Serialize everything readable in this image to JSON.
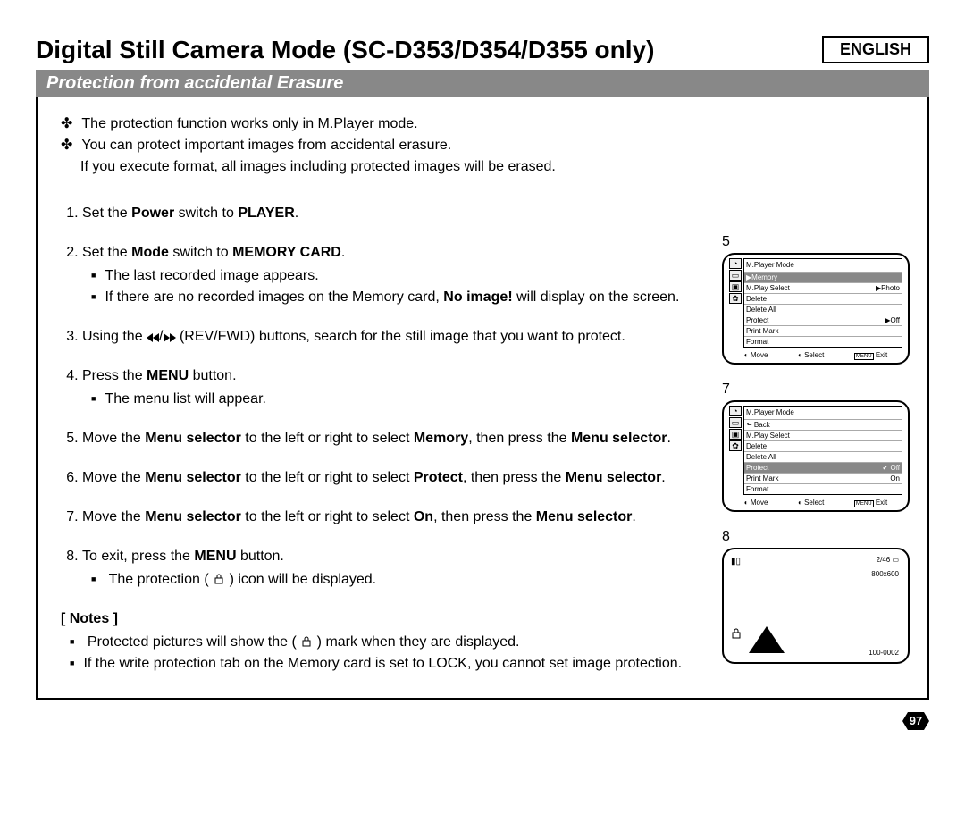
{
  "language": "ENGLISH",
  "title": "Digital Still Camera Mode (SC-D353/D354/D355 only)",
  "subtitle": "Protection from accidental Erasure",
  "intro": {
    "b1": "The protection function works only in M.Player mode.",
    "b2": "You can protect important images from accidental erasure.",
    "b2b": "If you execute format, all images including protected images will be erased."
  },
  "steps": {
    "s1a": "Set the ",
    "s1b": "Power",
    "s1c": " switch to ",
    "s1d": "PLAYER",
    "s1e": ".",
    "s2a": "Set the ",
    "s2b": "Mode",
    "s2c": " switch to ",
    "s2d": "MEMORY CARD",
    "s2e": ".",
    "s2sub1": "The last recorded image appears.",
    "s2sub2a": "If there are no recorded images on the Memory card, ",
    "s2sub2b": "No image!",
    "s2sub2c": " will display on the screen.",
    "s3a": "Using the ",
    "s3b": " (REV/FWD) buttons, search for the still image that you want to protect.",
    "s4a": "Press the ",
    "s4b": "MENU",
    "s4c": " button.",
    "s4sub1": "The menu list will appear.",
    "s5a": "Move the ",
    "s5b": "Menu selector",
    "s5c": " to the left or right to select ",
    "s5d": "Memory",
    "s5e": ", then press the ",
    "s5f": "Menu selector",
    "s5g": ".",
    "s6a": "Move the ",
    "s6b": "Menu selector",
    "s6c": " to the left or right to select ",
    "s6d": "Protect",
    "s6e": ", then press the ",
    "s6f": "Menu selector",
    "s6g": ".",
    "s7a": "Move the ",
    "s7b": "Menu selector",
    "s7c": " to the left or right to select ",
    "s7d": "On",
    "s7e": ", then press the ",
    "s7f": "Menu selector",
    "s7g": ".",
    "s8a": "To exit, press the ",
    "s8b": "MENU",
    "s8c": " button.",
    "s8sub1a": "The protection (",
    "s8sub1b": ") icon will be displayed."
  },
  "notes": {
    "head": "[ Notes ]",
    "n1a": "Protected pictures will show the (",
    "n1b": ") mark when they are displayed.",
    "n2": "If the write protection tab on the Memory card is set to LOCK, you cannot set image protection."
  },
  "fig5": {
    "num": "5",
    "mode": "M.Player Mode",
    "cat": "▶Memory",
    "i1": "M.Play Select",
    "i1v": "▶Photo",
    "i2": "Delete",
    "i3": "Delete All",
    "i4": "Protect",
    "i4v": "▶Off",
    "i5": "Print Mark",
    "i6": "Format",
    "bot_move": "Move",
    "bot_sel": "Select",
    "bot_exit": "Exit",
    "bot_menu": "MENU"
  },
  "fig7": {
    "num": "7",
    "mode": "M.Player Mode",
    "back": "Back",
    "i1": "M.Play Select",
    "i2": "Delete",
    "i3": "Delete All",
    "i4": "Protect",
    "i4v": "✔ Off",
    "i5": "Print Mark",
    "i5v": "On",
    "i6": "Format",
    "bot_move": "Move",
    "bot_sel": "Select",
    "bot_exit": "Exit",
    "bot_menu": "MENU"
  },
  "fig8": {
    "num": "8",
    "counter": "2/46",
    "res": "800x600",
    "fileno": "100-0002"
  },
  "pagenum": "97"
}
